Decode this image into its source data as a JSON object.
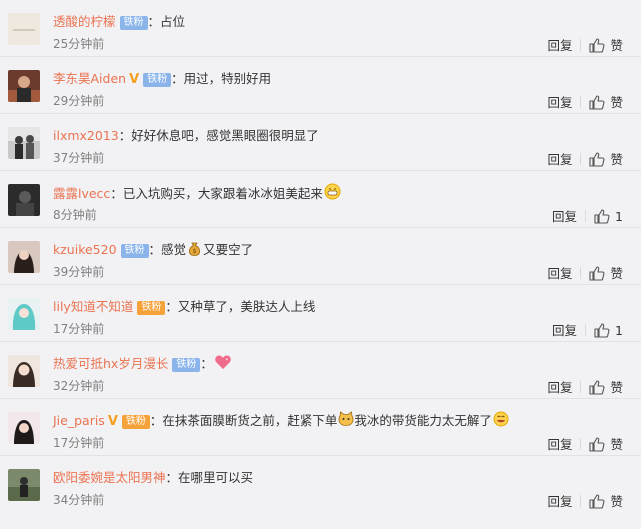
{
  "colors": {
    "username": "#eb7350",
    "fan_badge": "#8ab4ea",
    "time": "#808080"
  },
  "reply_label": "回复",
  "comments": [
    {
      "user": "透酸的柠檬",
      "badge": "铁粉",
      "text": "：占位",
      "time": "25分钟前",
      "like": "赞"
    },
    {
      "user": "李东昊Aiden",
      "badge": "铁粉",
      "text": "：用过，特别好用",
      "time": "29分钟前",
      "like": "赞"
    },
    {
      "user": "ilxmx2013",
      "text": "：好好休息吧，感觉黑眼圈很明显了",
      "time": "37分钟前",
      "like": "赞"
    },
    {
      "user": "露露lvecc",
      "text": "：已入坑购买，大家跟着冰冰姐美起来",
      "time": "8分钟前",
      "like": "1"
    },
    {
      "user": "kzuike520",
      "badge": "铁粉",
      "text": "：感觉",
      "text2": "又要空了",
      "time": "39分钟前",
      "like": "赞"
    },
    {
      "user": "lily知道不知道",
      "badge": "铁粉",
      "text": "：又种草了，美肤达人上线",
      "time": "17分钟前",
      "like": "1"
    },
    {
      "user": "热爱可抵hx岁月漫长",
      "badge": "铁粉",
      "text": "：",
      "time": "32分钟前",
      "like": "赞"
    },
    {
      "user": "Jie_paris",
      "badge": "铁粉",
      "text": "：在抹茶面膜断货之前，赶紧下单",
      "text2": "我冰的带货能力太无解了",
      "time": "17分钟前",
      "like": "赞"
    },
    {
      "user": "欧阳委婉是太阳男神",
      "text": "：在哪里可以买",
      "time": "34分钟前",
      "like": "赞"
    }
  ]
}
